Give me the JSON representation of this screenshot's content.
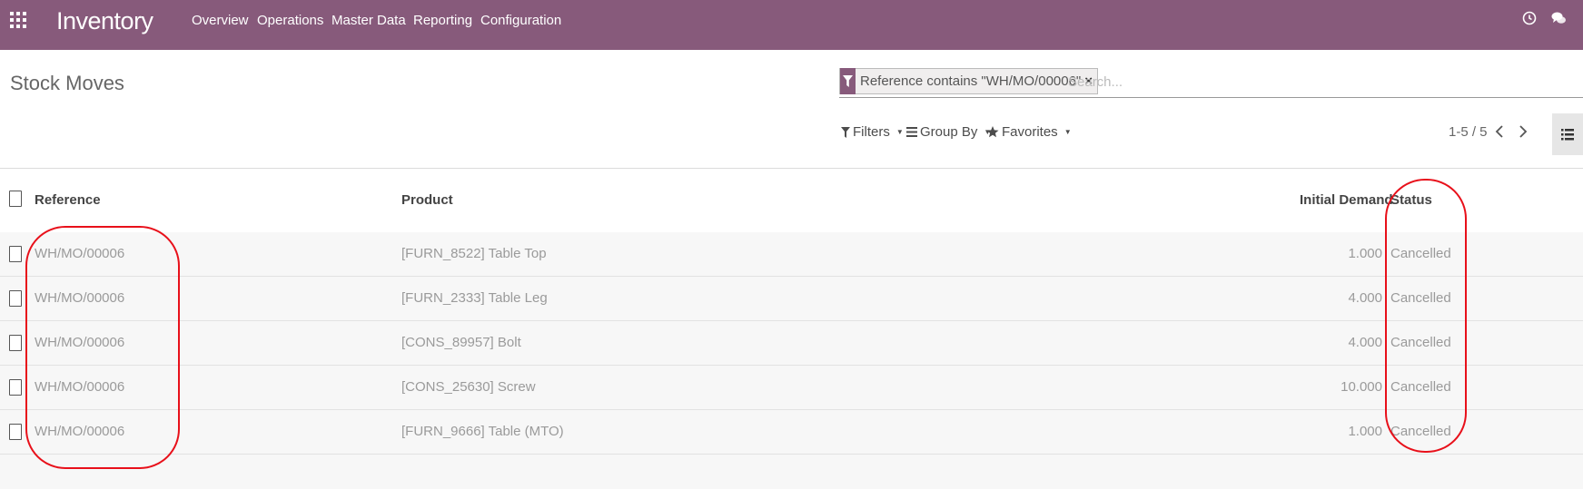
{
  "navbar": {
    "app_title": "Inventory",
    "menu": [
      "Overview",
      "Operations",
      "Master Data",
      "Reporting",
      "Configuration"
    ],
    "icons": [
      "apps-grid-icon",
      "clock-icon",
      "chat-icon"
    ]
  },
  "page": {
    "title": "Stock Moves"
  },
  "search": {
    "facet_label": "Reference contains \"WH/MO/00006\"",
    "facet_remove": "×",
    "placeholder": "Search..."
  },
  "toolbar": {
    "filters_label": "Filters",
    "group_by_label": "Group By",
    "favorites_label": "Favorites",
    "pager_text": "1-5 / 5"
  },
  "table": {
    "columns": {
      "reference": "Reference",
      "product": "Product",
      "initial_demand": "Initial Demand",
      "status": "Status"
    },
    "rows": [
      {
        "reference": "WH/MO/00006",
        "product": "[FURN_8522] Table Top",
        "initial_demand": "1.000",
        "status": "Cancelled"
      },
      {
        "reference": "WH/MO/00006",
        "product": "[FURN_2333] Table Leg",
        "initial_demand": "4.000",
        "status": "Cancelled"
      },
      {
        "reference": "WH/MO/00006",
        "product": "[CONS_89957] Bolt",
        "initial_demand": "4.000",
        "status": "Cancelled"
      },
      {
        "reference": "WH/MO/00006",
        "product": "[CONS_25630] Screw",
        "initial_demand": "10.000",
        "status": "Cancelled"
      },
      {
        "reference": "WH/MO/00006",
        "product": "[FURN_9666] Table (MTO)",
        "initial_demand": "1.000",
        "status": "Cancelled"
      }
    ]
  },
  "colors": {
    "brand": "#875a7b",
    "annotation": "#e8101a"
  }
}
